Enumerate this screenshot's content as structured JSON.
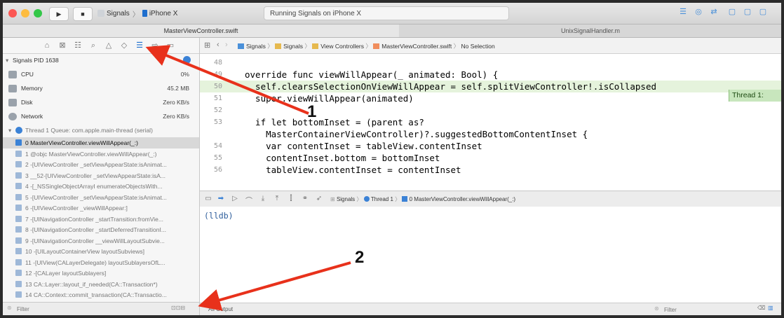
{
  "toolbar": {
    "scheme": "Signals",
    "device": "iPhone X",
    "activity": "Running Signals on iPhone X",
    "colors": {
      "close": "#fc5753",
      "minimize": "#fdbc40",
      "zoom": "#33c748"
    }
  },
  "tabs": [
    {
      "label": "MasterViewController.swift"
    },
    {
      "label": ""
    },
    {
      "label": "UnixSignalHandler.m"
    }
  ],
  "navigator": {
    "process": "Signals PID 1638",
    "gauges": [
      {
        "label": "CPU",
        "value": "0%"
      },
      {
        "label": "Memory",
        "value": "45.2 MB"
      },
      {
        "label": "Disk",
        "value": "Zero KB/s"
      },
      {
        "label": "Network",
        "value": "Zero KB/s"
      }
    ],
    "thread": "Thread 1 Queue: com.apple.main-thread (serial)",
    "frames": [
      "0 MasterViewController.viewWillAppear(_:)",
      "1 @objc MasterViewController.viewWillAppear(_:)",
      "2 -[UIViewController _setViewAppearState:isAnimat...",
      "3 __52-[UIViewController _setViewAppearState:isA...",
      "4 -[_NSSingleObjectArrayI enumerateObjectsWith...",
      "5 -[UIViewController _setViewAppearState:isAnimat...",
      "6 -[UIViewController _viewWillAppear:]",
      "7 -[UINavigationController _startTransition:fromVie...",
      "8 -[UINavigationController _startDeferredTransitionI...",
      "9 -[UINavigationController __viewWillLayoutSubvie...",
      "10 -[UILayoutContainerView layoutSubviews]",
      "11 -[UIView(CALayerDelegate) layoutSublayersOfL...",
      "12 -[CALayer layoutSublayers]",
      "13 CA::Layer::layout_if_needed(CA::Transaction*)",
      "14 CA::Context::commit_transaction(CA::Transactio..."
    ],
    "filter_placeholder": "Filter"
  },
  "jumpbar": {
    "crumbs": [
      "Signals",
      "Signals",
      "View Controllers",
      "MasterViewController.swift",
      "No Selection"
    ]
  },
  "editor": {
    "lines": [
      {
        "n": "48",
        "code": ""
      },
      {
        "n": "49",
        "code": "override func viewWillAppear(_ animated: Bool) {"
      },
      {
        "n": "50",
        "code": "  self.clearsSelectionOnViewWillAppear = self.splitViewController!.isCollapsed"
      },
      {
        "n": "51",
        "code": "  super.viewWillAppear(animated)"
      },
      {
        "n": "52",
        "code": ""
      },
      {
        "n": "53",
        "code": "  if let bottomInset = (parent as?"
      },
      {
        "n": "",
        "code": "    MasterContainerViewController)?.suggestedBottomContentInset {"
      },
      {
        "n": "54",
        "code": "    var contentInset = tableView.contentInset"
      },
      {
        "n": "55",
        "code": "    contentInset.bottom = bottomInset"
      },
      {
        "n": "56",
        "code": "    tableView.contentInset = contentInset"
      }
    ],
    "thread_badge": "Thread 1:"
  },
  "debugbar": {
    "crumbs": [
      "Signals",
      "Thread 1",
      "0 MasterViewController.viewWillAppear(_:)"
    ]
  },
  "console": {
    "prompt": "(lldb)"
  },
  "bottombar": {
    "output": "All Output",
    "filter_placeholder": "Filter"
  },
  "annotations": {
    "one": "1",
    "two": "2",
    "color": "#e8311b"
  }
}
